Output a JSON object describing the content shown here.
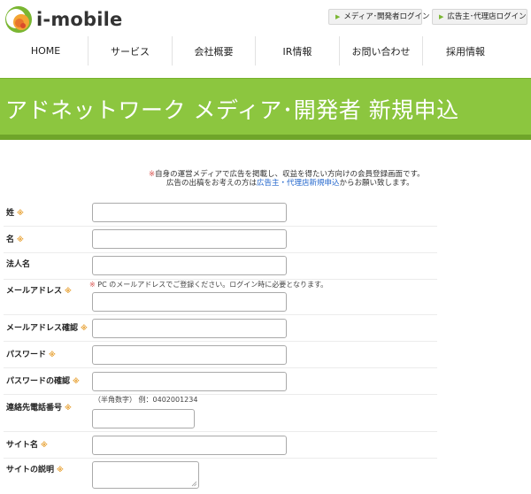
{
  "header": {
    "logo_text": "i-mobile",
    "media_login": "メディア･開発者ログイン",
    "advertiser_login": "広告主･代理店ログイン"
  },
  "nav": [
    {
      "label": "HOME"
    },
    {
      "label": "サービス"
    },
    {
      "label": "会社概要"
    },
    {
      "label": "IR情報"
    },
    {
      "label": "お問い合わせ"
    },
    {
      "label": "採用情報"
    }
  ],
  "banner": {
    "title": "アドネットワーク メディア･開発者 新規申込"
  },
  "intro": {
    "mark": "※",
    "line1": "自身の運営メディアで広告を掲載し、収益を得たい方向けの会員登録画面です。",
    "line2_prefix": "広告の出稿をお考えの方は",
    "line2_link": "広告主・代理店新規申込",
    "line2_suffix": "からお願い致します。"
  },
  "form": {
    "required_mark": "※",
    "last_name": {
      "label": "姓"
    },
    "first_name": {
      "label": "名"
    },
    "company": {
      "label": "法人名"
    },
    "email": {
      "label": "メールアドレス",
      "help": "PC のメールアドレスでご登録ください。ログイン時に必要となります。"
    },
    "email_confirm": {
      "label": "メールアドレス確認"
    },
    "password": {
      "label": "パスワード"
    },
    "password_confirm": {
      "label": "パスワードの確認"
    },
    "phone": {
      "label": "連絡先電話番号",
      "help": "（半角数字） 例：0402001234"
    },
    "site_name": {
      "label": "サイト名"
    },
    "site_description": {
      "label": "サイトの説明"
    }
  },
  "colors": {
    "brand_green": "#8cc63f",
    "link_blue": "#2266cc",
    "required_orange": "#e8a43a",
    "note_red": "#d9534f"
  }
}
